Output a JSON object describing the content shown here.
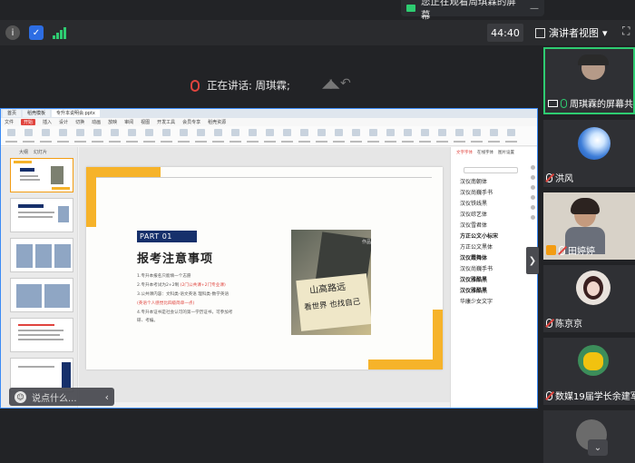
{
  "banner": {
    "text": "您正在观看周琪霖的屏幕"
  },
  "toolbar": {
    "timer": "44:40",
    "presenter_view": "演讲者视图"
  },
  "speaking": {
    "label": "正在讲话: 周琪霖;"
  },
  "wps": {
    "tabs": [
      "首页",
      "稻壳模板",
      "专升本说明会.pptx"
    ],
    "menu": [
      "文件",
      "开始",
      "插入",
      "设计",
      "切换",
      "动画",
      "放映",
      "审阅",
      "视图",
      "开发工具",
      "会员专享",
      "稻壳资源"
    ],
    "thumbs_header": [
      "大纲",
      "幻灯片"
    ],
    "slide": {
      "part": "PART 01",
      "title": "报考注意事项",
      "bullets": [
        {
          "text": "1.专升本报名只能填一个志愿",
          "red": ""
        },
        {
          "text": "2.专升本考试为2+2制 ",
          "red": "(2门公共课+2门专业课)"
        },
        {
          "text": "3.公共课内容：文科类-语文英语  理科类-数学英语",
          "red": ""
        },
        {
          "text": "",
          "red": "(英语个人感觉比四级简单一点)"
        },
        {
          "text": "4.专升本证书是社会认可的第一学历证书，可参加考",
          "red": ""
        },
        {
          "text": "研、考编。",
          "red": ""
        }
      ],
      "photo_line1": "山高路远",
      "photo_line2": "看世界 也找自己",
      "photo_sig": "作品"
    },
    "fontpanel": {
      "tabs": [
        "文字字体",
        "在线字体",
        "图片设置"
      ],
      "items": [
        "汉仪南朝体",
        "汉仪尚巍手书",
        "汉仪铁线黑",
        "汉仪综艺体",
        "汉仪雪君体",
        "方正公文小标宋",
        "方正公文黑体",
        "汉仪霞舞体",
        "汉仪尚巍手书",
        "汉仪雅酷黑",
        "汉仪雅酷黑",
        "华康少女文字"
      ]
    }
  },
  "chat": {
    "placeholder": "说点什么..."
  },
  "participants": [
    {
      "name": "周琪霖的屏幕共享"
    },
    {
      "name": "洪风"
    },
    {
      "name": "田婷婷"
    },
    {
      "name": "陈京京"
    },
    {
      "name": "数媒19届学长余建军"
    }
  ]
}
